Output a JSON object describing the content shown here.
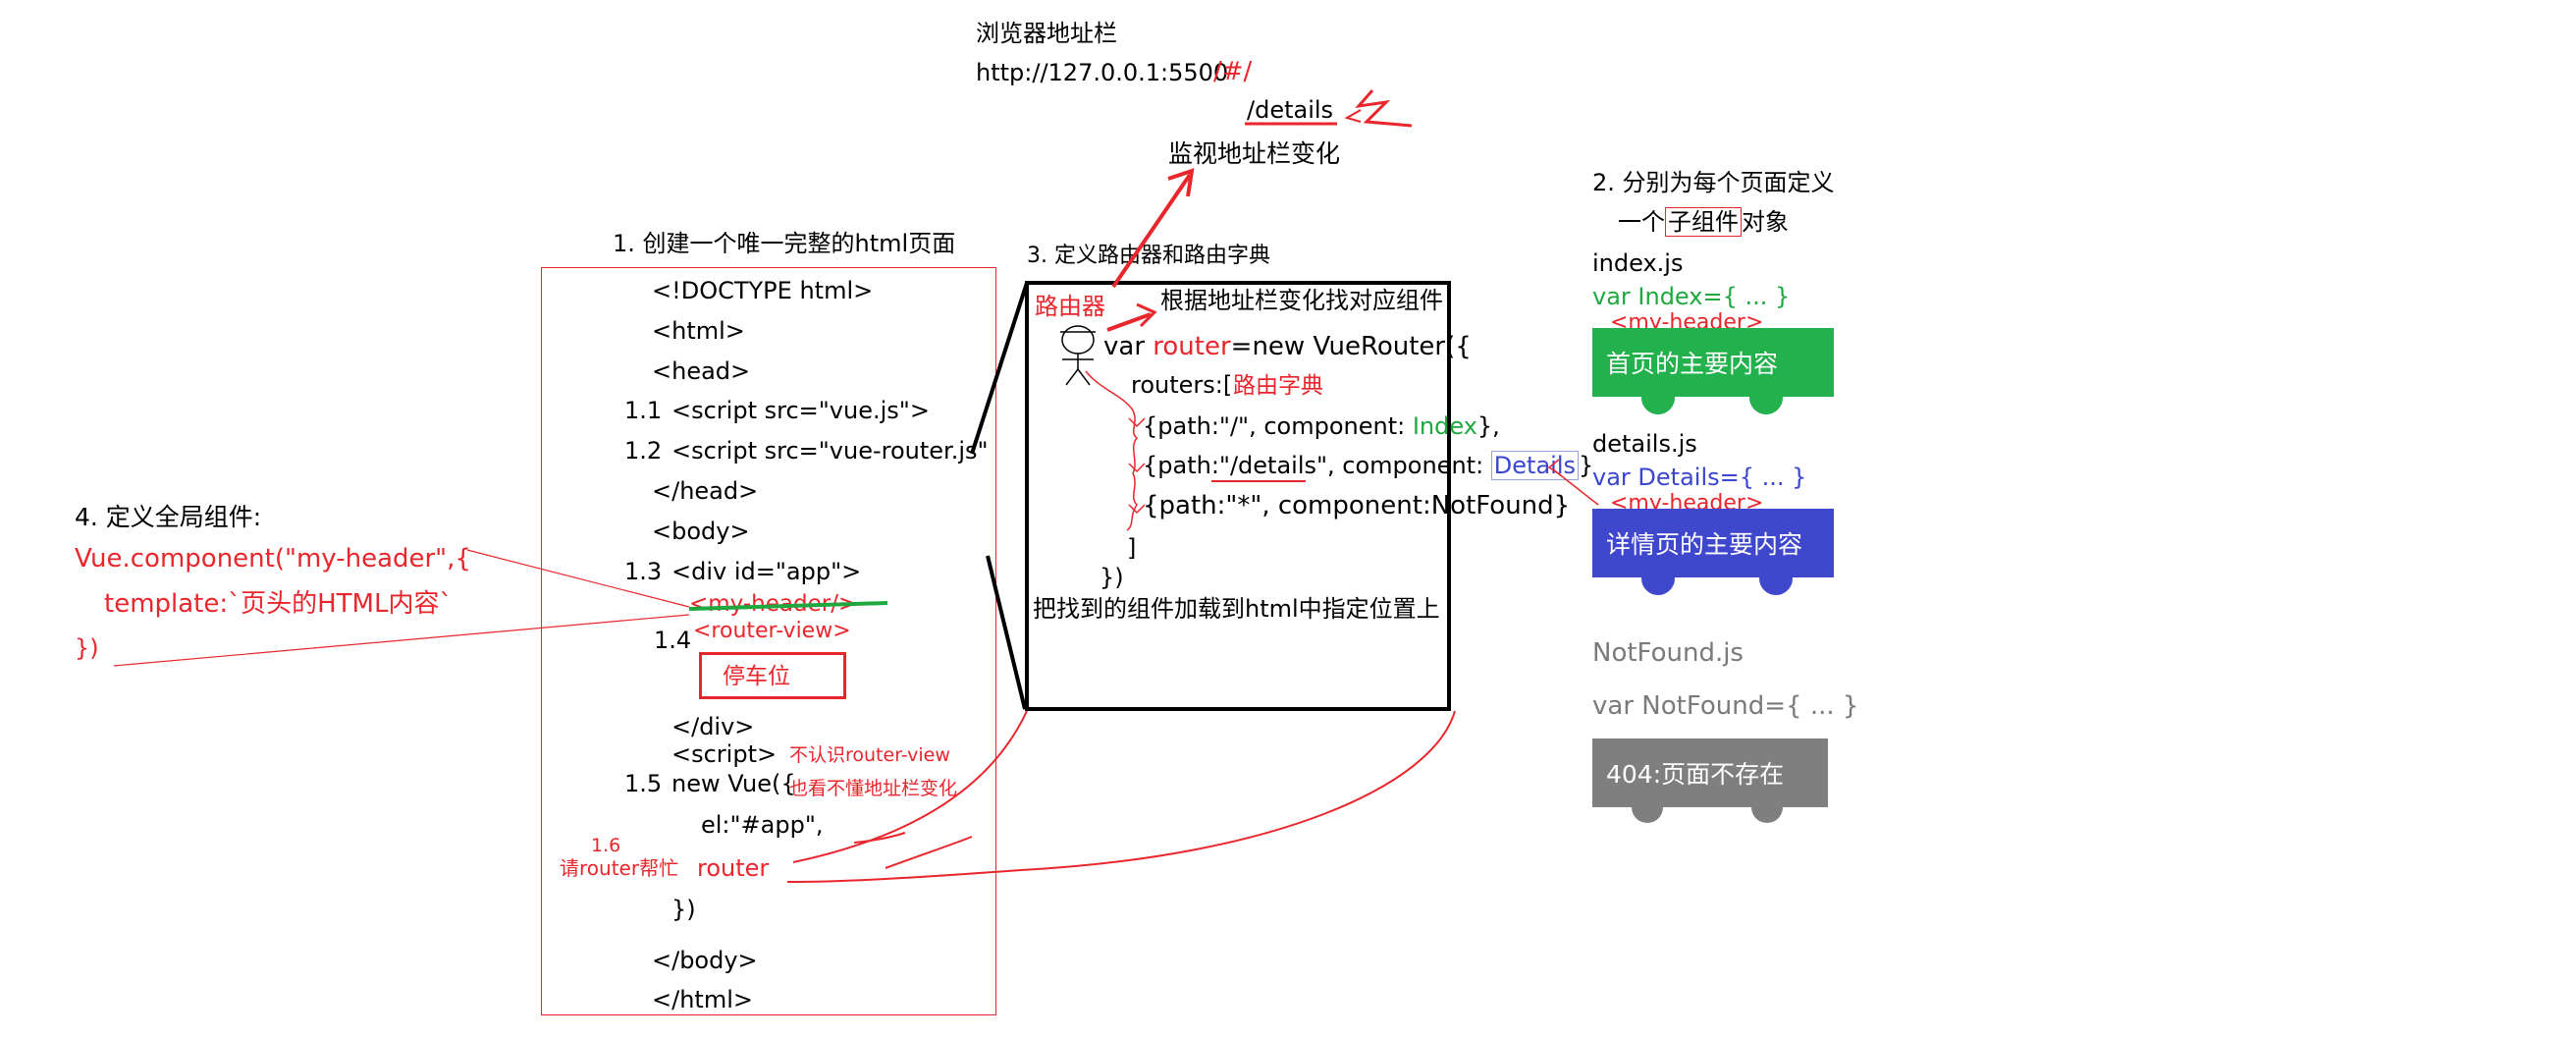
{
  "address_bar": {
    "title": "浏览器地址栏",
    "url_base": "http://127.0.0.1:5500",
    "url_hash": "/#/",
    "path": "/details",
    "watch_label": "监视地址栏变化"
  },
  "step1": {
    "title": "1. 创建一个唯一完整的html页面",
    "lines": {
      "doctype": "<!DOCTYPE html>",
      "html_open": "<html>",
      "head_open": "<head>",
      "n11": "1.1",
      "script_vue": "<script src=\"vue.js\">",
      "n12": "1.2",
      "script_router": "<script src=\"vue-router.js\"",
      "head_close": "</head>",
      "body_open": "<body>",
      "n13": "1.3",
      "div_app": "<div id=\"app\">",
      "my_header": "<my-header/>",
      "n14": "1.4",
      "router_view": "<router-view>",
      "parking": "停车位",
      "div_close": "</div>",
      "script_open": "<script>",
      "n15": "1.5",
      "new_vue": "new Vue({",
      "el": "el:\"#app\",",
      "n16": "1.6",
      "ask_router": "请router帮忙",
      "router_word": "router",
      "close_vue": "})",
      "body_close": "</body>",
      "html_close": "</html>",
      "note1": "不认识router-view",
      "note2": "也看不懂地址栏变化"
    }
  },
  "step3": {
    "title": "3. 定义路由器和路由字典",
    "router_label": "路由器",
    "find_label": "根据地址栏变化找对应组件",
    "code": {
      "var": "var ",
      "router": "router",
      "new_router": "=new VueRouter({",
      "routers": "routers:[",
      "dict_label": "路由字典",
      "r1_a": "{path:\"/\", component: ",
      "r1_b": "Index",
      "r1_c": "},",
      "r2_a": "{path:\"/details\", component: ",
      "r2_b": "Details",
      "r2_c": "}",
      "r3": "{path:\"*\", component:NotFound}",
      "bracket_close": "]",
      "close": "})"
    },
    "load_label": "把找到的组件加载到html中指定位置上"
  },
  "step4": {
    "title": "4. 定义全局组件:",
    "line1": "Vue.component(\"my-header\",{",
    "line2": "template:`页头的HTML内容`",
    "line3": "})"
  },
  "step2": {
    "title_1": "2. 分别为每个页面定义",
    "title_2a": "一个",
    "title_2b": "子组件",
    "title_2c": "对象",
    "components": [
      {
        "file": "index.js",
        "decl": "var Index={ ... }",
        "header": "<my-header>",
        "content": "首页的主要内容",
        "color": "#22b14c",
        "decl_color": "#1fa83f"
      },
      {
        "file": "details.js",
        "decl": "var Details={ ... }",
        "header": "<my-header>",
        "content": "详情页的主要内容",
        "color": "#3f48cc",
        "decl_color": "#3a45d0"
      },
      {
        "file": "NotFound.js",
        "decl": "var NotFound={ ... }",
        "header": "",
        "content": "404:页面不存在",
        "color": "#7f7f7f",
        "decl_color": "#7a7a7a"
      }
    ]
  }
}
